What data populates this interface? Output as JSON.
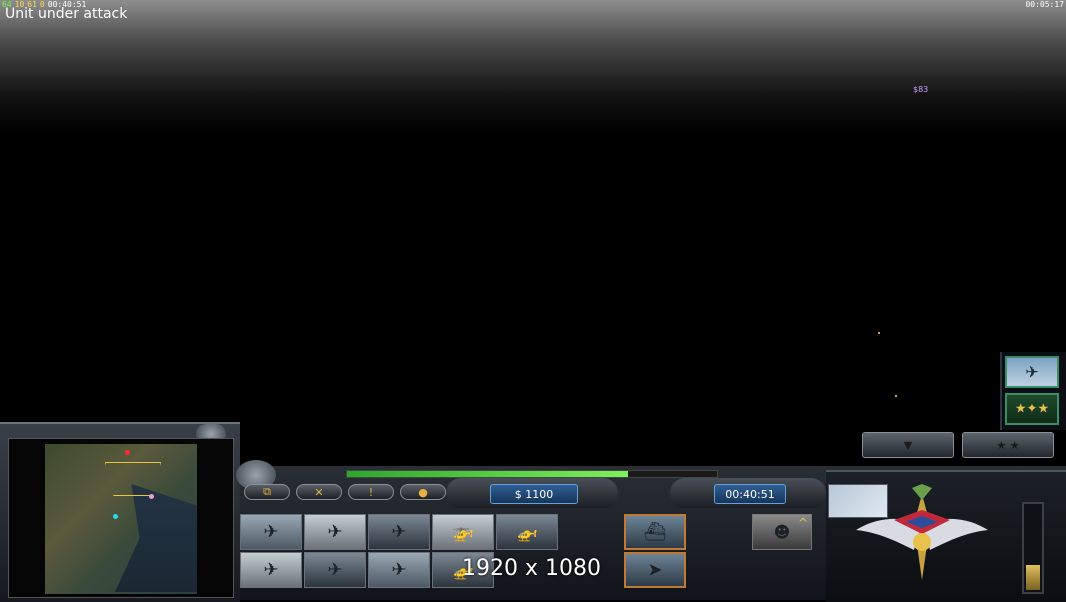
{
  "hud": {
    "fps": "64",
    "ping_a": "10",
    "ping_b": "61",
    "ping_c": "0",
    "match_clock": "00:40:51",
    "session_clock": "00:05:17",
    "alert_message": "Unit under attack",
    "money_popup": "$83"
  },
  "console": {
    "money": "$ 1100",
    "timer": "00:40:51",
    "resolution_label": "1920 x 1080",
    "power_level": 0.76,
    "energy_level": 0.3,
    "command_buttons": [
      {
        "name": "select-all",
        "icon": "stack-icon",
        "glyph": "⧉"
      },
      {
        "name": "repair",
        "icon": "wrench-icon",
        "glyph": "✕"
      },
      {
        "name": "alert",
        "icon": "alert-icon",
        "glyph": "!"
      },
      {
        "name": "chat",
        "icon": "chat-icon",
        "glyph": "●"
      }
    ],
    "tabs": [
      {
        "name": "tab-down",
        "glyph": "▼"
      },
      {
        "name": "tab-stars",
        "glyph": "★ ★"
      }
    ],
    "build_items": [
      {
        "name": "build-fighter-jet",
        "glyph": "✈"
      },
      {
        "name": "build-hornet-jet",
        "glyph": "✈"
      },
      {
        "name": "build-stealth-bomber",
        "glyph": "✈"
      },
      {
        "name": "build-chinook-helicopter",
        "glyph": "🚁"
      },
      {
        "name": "build-comanche-helicopter",
        "glyph": "🚁"
      },
      {
        "name": "build-raptor-jet",
        "glyph": "✈"
      },
      {
        "name": "build-aurora-jet",
        "glyph": "✈"
      },
      {
        "name": "build-stealth-fighter",
        "glyph": "✈"
      },
      {
        "name": "build-blackhawk",
        "glyph": "🚁"
      }
    ],
    "queue_items": [
      {
        "name": "queue-aircraft-carrier"
      },
      {
        "name": "queue-missile"
      }
    ]
  },
  "colors": {
    "power": "#56d43a",
    "readout": "#2f5f96",
    "alert_text": "#ffffff",
    "queue_border": "#c07a34"
  }
}
